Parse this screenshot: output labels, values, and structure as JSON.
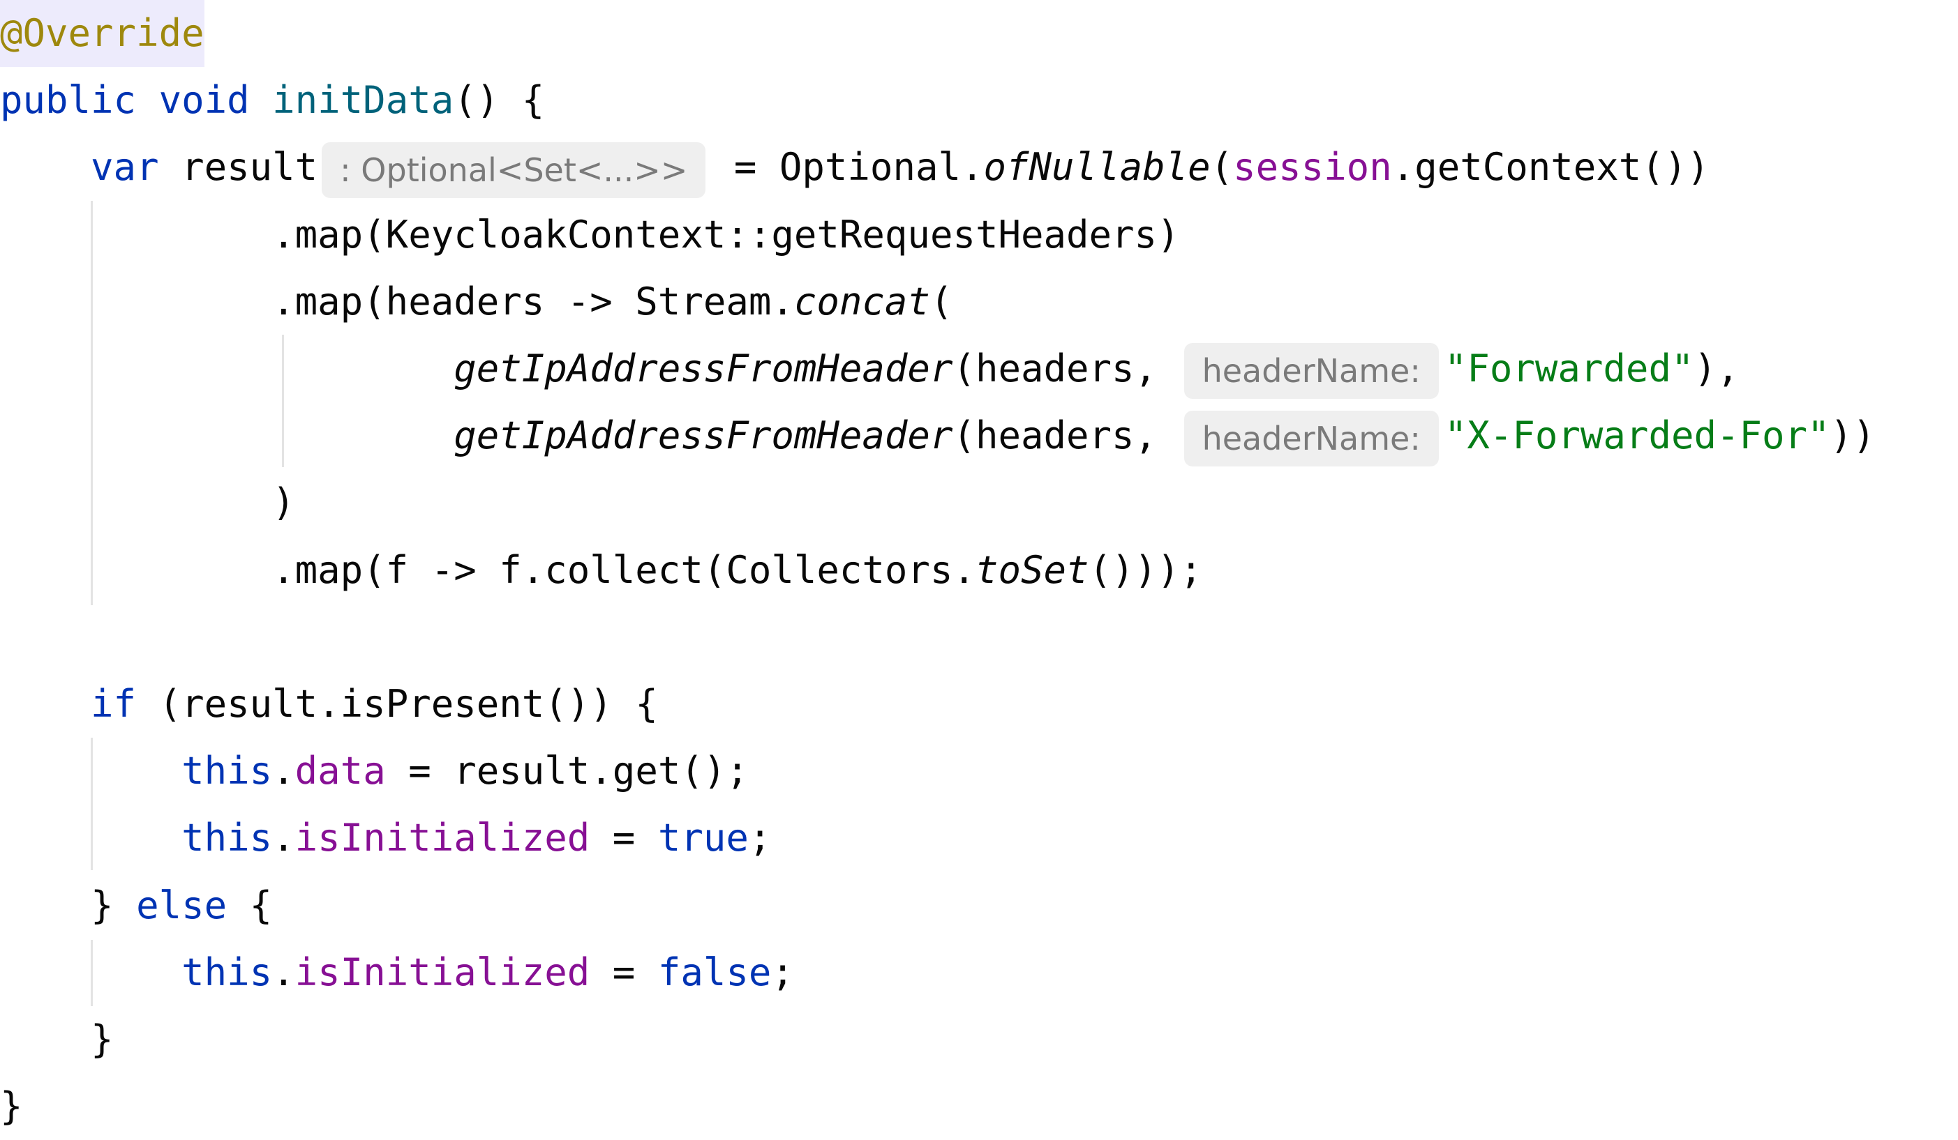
{
  "editor": {
    "language": "Java",
    "colors": {
      "keyword": "#0033b3",
      "annotation": "#9e880d",
      "annotation_highlight": "#edebfc",
      "method_declaration": "#00627a",
      "field": "#871094",
      "string": "#067d17",
      "plain": "#080808",
      "inlay_hint_text": "#7a7a7a",
      "inlay_hint_background": "#efefef",
      "indent_guide": "#e3e3e3"
    },
    "lines": [
      {
        "tokens": [
          {
            "text": "@Override",
            "style": "ann"
          }
        ]
      },
      {
        "tokens": [
          {
            "text": "public void ",
            "style": "kw"
          },
          {
            "text": "initData",
            "style": "fn"
          },
          {
            "text": "() {",
            "style": "plain"
          }
        ]
      },
      {
        "tokens": [
          {
            "text": "    ",
            "style": "plain"
          },
          {
            "text": "var",
            "style": "kw"
          },
          {
            "text": " result",
            "style": "plain"
          },
          {
            "hint": ": Optional<Set<...>>"
          },
          {
            "text": " = Optional.",
            "style": "plain"
          },
          {
            "text": "ofNullable",
            "style": "st"
          },
          {
            "text": "(",
            "style": "plain"
          },
          {
            "text": "session",
            "style": "fld"
          },
          {
            "text": ".getContext())",
            "style": "plain"
          }
        ]
      },
      {
        "tokens": [
          {
            "text": "            .map(KeycloakContext::getRequestHeaders)",
            "style": "plain"
          }
        ]
      },
      {
        "tokens": [
          {
            "text": "            .map(headers -> Stream.",
            "style": "plain"
          },
          {
            "text": "concat",
            "style": "st"
          },
          {
            "text": "(",
            "style": "plain"
          }
        ]
      },
      {
        "tokens": [
          {
            "text": "                    ",
            "style": "plain"
          },
          {
            "text": "getIpAddressFromHeader",
            "style": "st"
          },
          {
            "text": "(headers, ",
            "style": "plain"
          },
          {
            "hint": "headerName:"
          },
          {
            "text": "\"Forwarded\"",
            "style": "str"
          },
          {
            "text": "),",
            "style": "plain"
          }
        ]
      },
      {
        "tokens": [
          {
            "text": "                    ",
            "style": "plain"
          },
          {
            "text": "getIpAddressFromHeader",
            "style": "st"
          },
          {
            "text": "(headers, ",
            "style": "plain"
          },
          {
            "hint": "headerName:"
          },
          {
            "text": "\"X-Forwarded-For\"",
            "style": "str"
          },
          {
            "text": "))",
            "style": "plain"
          }
        ]
      },
      {
        "tokens": [
          {
            "text": "            )",
            "style": "plain"
          }
        ]
      },
      {
        "tokens": [
          {
            "text": "            .map(f -> f.collect(Collectors.",
            "style": "plain"
          },
          {
            "text": "toSet",
            "style": "st"
          },
          {
            "text": "()));",
            "style": "plain"
          }
        ]
      },
      {
        "tokens": []
      },
      {
        "tokens": [
          {
            "text": "    ",
            "style": "plain"
          },
          {
            "text": "if",
            "style": "kw"
          },
          {
            "text": " (result.isPresent()) {",
            "style": "plain"
          }
        ]
      },
      {
        "tokens": [
          {
            "text": "        ",
            "style": "plain"
          },
          {
            "text": "this",
            "style": "kw"
          },
          {
            "text": ".",
            "style": "plain"
          },
          {
            "text": "data",
            "style": "fld"
          },
          {
            "text": " = result.get();",
            "style": "plain"
          }
        ]
      },
      {
        "tokens": [
          {
            "text": "        ",
            "style": "plain"
          },
          {
            "text": "this",
            "style": "kw"
          },
          {
            "text": ".",
            "style": "plain"
          },
          {
            "text": "isInitialized",
            "style": "fld"
          },
          {
            "text": " = ",
            "style": "plain"
          },
          {
            "text": "true",
            "style": "kw"
          },
          {
            "text": ";",
            "style": "plain"
          }
        ]
      },
      {
        "tokens": [
          {
            "text": "    } ",
            "style": "plain"
          },
          {
            "text": "else",
            "style": "kw"
          },
          {
            "text": " {",
            "style": "plain"
          }
        ]
      },
      {
        "tokens": [
          {
            "text": "        ",
            "style": "plain"
          },
          {
            "text": "this",
            "style": "kw"
          },
          {
            "text": ".",
            "style": "plain"
          },
          {
            "text": "isInitialized",
            "style": "fld"
          },
          {
            "text": " = ",
            "style": "plain"
          },
          {
            "text": "false",
            "style": "kw"
          },
          {
            "text": ";",
            "style": "plain"
          }
        ]
      },
      {
        "tokens": [
          {
            "text": "    }",
            "style": "plain"
          }
        ]
      },
      {
        "tokens": [
          {
            "text": "}",
            "style": "plain"
          }
        ]
      }
    ]
  }
}
